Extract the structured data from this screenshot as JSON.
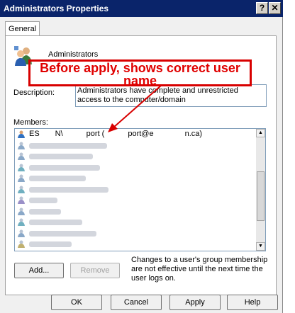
{
  "window": {
    "title": "Administrators Properties",
    "help_label": "?",
    "close_label": "✕"
  },
  "tabs": [
    {
      "label": "General"
    }
  ],
  "group": {
    "name": "Administrators",
    "description_label": "Description:",
    "description": "Administrators have complete and unrestricted access to the computer/domain"
  },
  "members": {
    "label": "Members:",
    "first_member": "ES  N\\   port (   port@e    n.ca)"
  },
  "annotation": {
    "text": "Before apply, shows correct user name"
  },
  "buttons": {
    "add": "Add...",
    "remove": "Remove",
    "ok": "OK",
    "cancel": "Cancel",
    "apply": "Apply",
    "help": "Help"
  },
  "notice": "Changes to a user's group membership are not effective until the next time the user logs on.",
  "colors": {
    "annotation": "#d80000",
    "titlebar": "#0a246a"
  },
  "icons": {
    "group": "group-icon",
    "user": "user-icon",
    "arrow": "annotation-arrow"
  }
}
